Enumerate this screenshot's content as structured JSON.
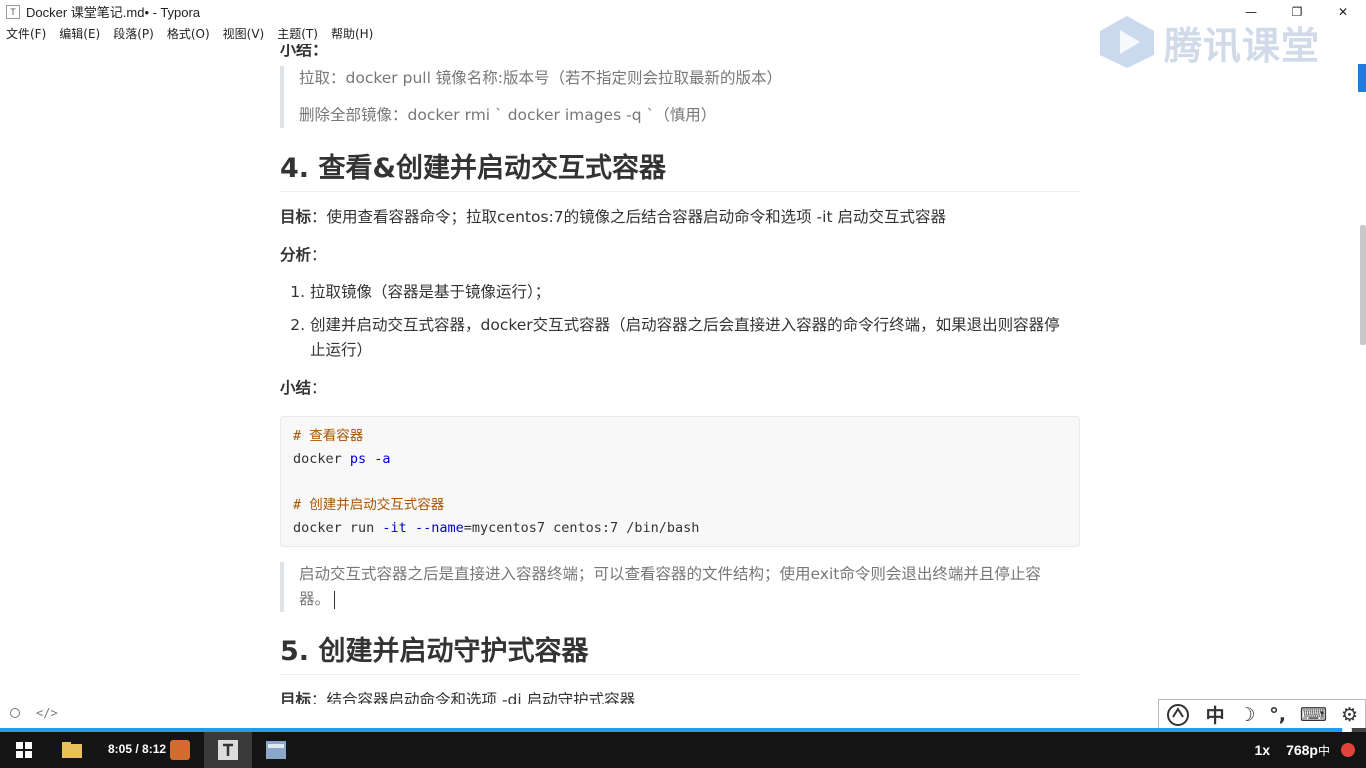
{
  "window": {
    "title": "Docker 课堂笔记.md• - Typora",
    "icon_letter": "T",
    "controls": [
      "—",
      "❐",
      "✕"
    ]
  },
  "menu": [
    "文件(F)",
    "编辑(E)",
    "段落(P)",
    "格式(O)",
    "视图(V)",
    "主题(T)",
    "帮助(H)"
  ],
  "watermark": {
    "text": "腾讯课堂"
  },
  "doc": {
    "cut_label": "小结：",
    "quote1": [
      "拉取：docker pull 镜像名称:版本号（若不指定则会拉取最新的版本）",
      "删除全部镜像：docker rmi ` docker images -q `（慎用）"
    ],
    "h4": "4. 查看&创建并启动交互式容器",
    "goal4_label": "目标",
    "goal4_text": "：使用查看容器命令；拉取centos:7的镜像之后结合容器启动命令和选项 -it 启动交互式容器",
    "analysis_label": "分析",
    "analysis_colon": "：",
    "list": [
      {
        "num": "1.",
        "text": "拉取镜像（容器是基于镜像运行）；"
      },
      {
        "num": "2.",
        "text": "创建并启动交互式容器，docker交互式容器（启动容器之后会直接进入容器的命令行终端，如果退出则容器停止运行）"
      }
    ],
    "summary_label": "小结",
    "summary_colon": "：",
    "code": {
      "comment1": "# 查看容器",
      "l2_cmd": "docker ",
      "l2_kw": "ps",
      "l2_opt": " -a",
      "comment2": "# 创建并启动交互式容器",
      "l4_cmd": "docker run ",
      "l4_opt1": "-it",
      "l4_sp": " ",
      "l4_opt2": "--name",
      "l4_rest": "=mycentos7 centos:7 /bin/bash"
    },
    "quote2": "启动交互式容器之后是直接进入容器终端；可以查看容器的文件结构；使用exit命令则会退出终端并且停止容器。",
    "h5": "5. 创建并启动守护式容器",
    "goal5_label": "目标",
    "goal5_text": "：结合容器启动命令和选项 -di 启动守护式容器"
  },
  "status": {
    "source_toggle": "</>"
  },
  "ime": [
    "中",
    "☽",
    "°,",
    "⌨",
    "⚙"
  ],
  "player": {
    "time": "8:05 / 8:12",
    "speed": "1x",
    "resolution": "768p",
    "progress": 0.986,
    "lang": "中"
  },
  "colors": {
    "accent": "#1e9ff0",
    "taskbar": "#141414",
    "code_comment": "#aa5500",
    "code_keyword": "#0000cc"
  }
}
